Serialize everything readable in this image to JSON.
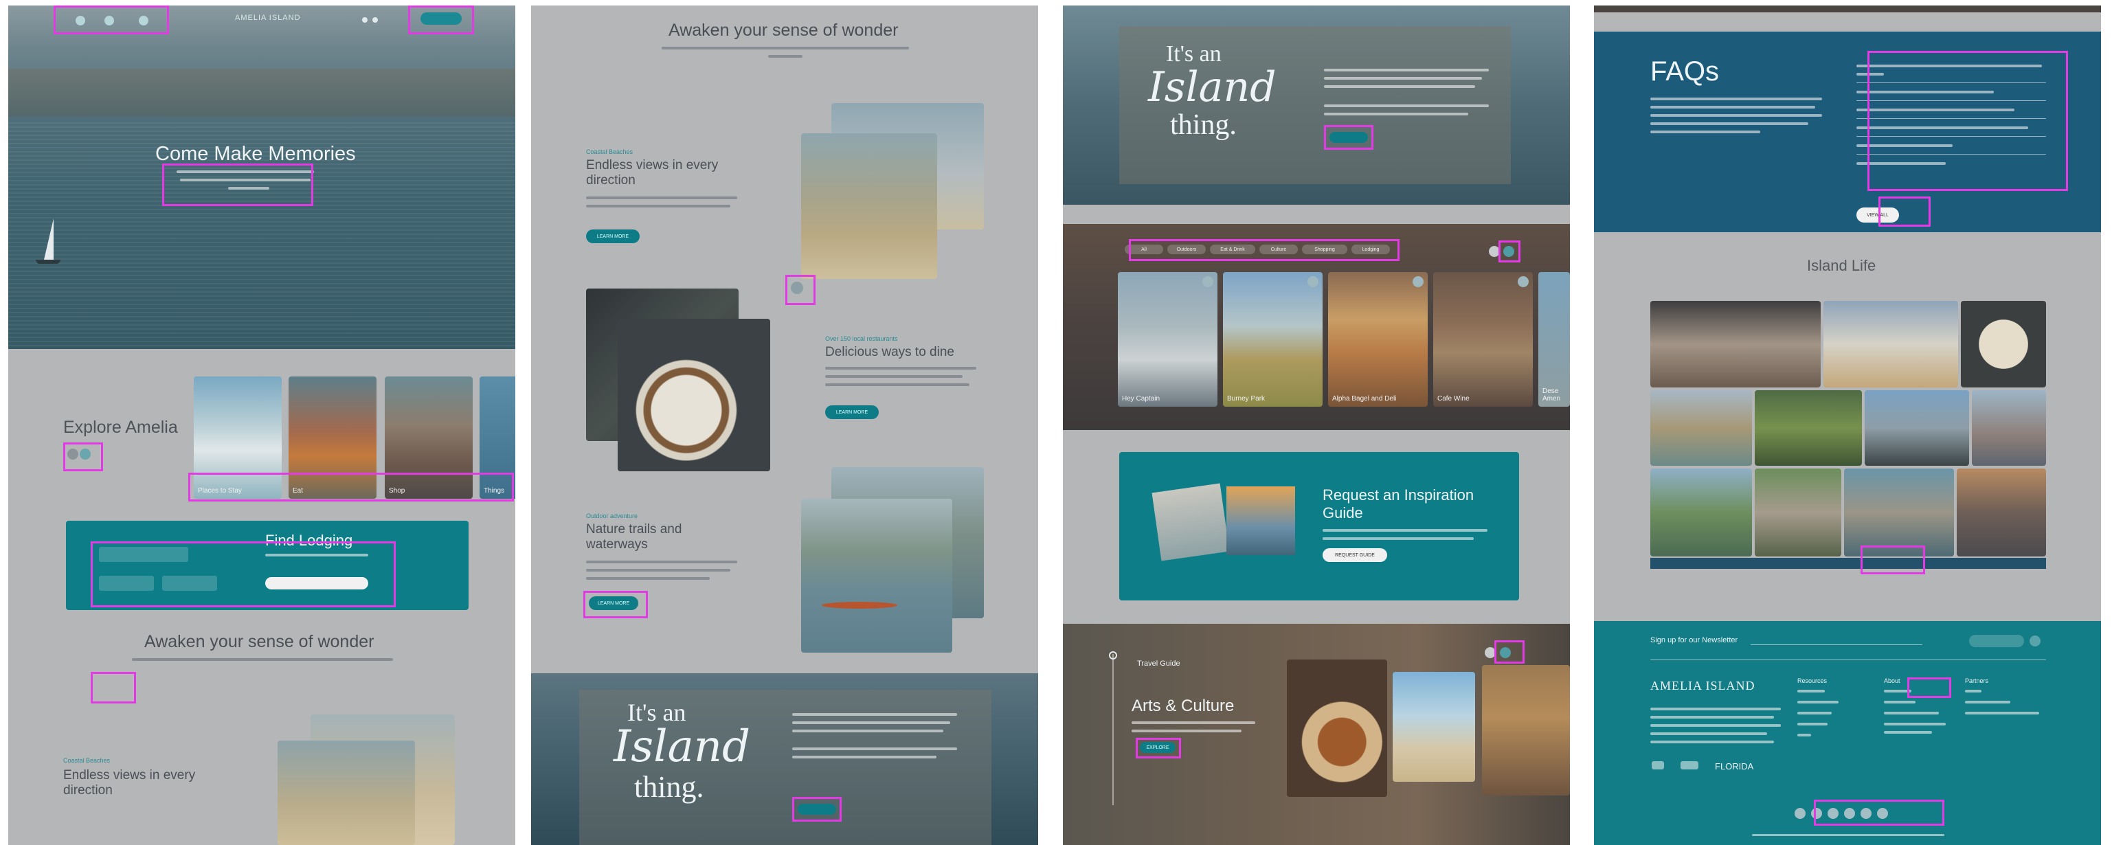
{
  "panel1": {
    "site_logo": "AMELIA ISLAND",
    "hero_title": "Come Make Memories",
    "explore_title": "Explore Amelia",
    "cards": [
      {
        "label": "Places to Stay"
      },
      {
        "label": "Eat"
      },
      {
        "label": "Shop"
      },
      {
        "label": "Things"
      }
    ],
    "find_lodging": "Find Lodging",
    "awaken_title": "Awaken your sense of wonder",
    "views_eyebrow": "Coastal Beaches",
    "views_title": "Endless views in every direction"
  },
  "panel2": {
    "awaken_title": "Awaken your sense of wonder",
    "sections": [
      {
        "eyebrow": "Coastal Beaches",
        "title": "Endless views in every direction",
        "button": "LEARN MORE"
      },
      {
        "eyebrow": "Over 150 local restaurants",
        "title": "Delicious ways to dine",
        "button": "LEARN MORE"
      },
      {
        "eyebrow": "Outdoor adventure",
        "title": "Nature trails and waterways",
        "button": "LEARN MORE"
      }
    ],
    "island_its_an": "It's an",
    "island_island": "Island",
    "island_thing": "thing."
  },
  "panel3": {
    "island_its_an": "It's an",
    "island_island": "Island",
    "island_thing": "thing.",
    "filter_tabs": [
      "All",
      "Outdoors",
      "Eat & Drink",
      "Culture",
      "Shopping",
      "Lodging"
    ],
    "carousel": [
      {
        "label": "Hey Captain"
      },
      {
        "label": "Burney Park"
      },
      {
        "label": "Alpha Bagel and Deli"
      },
      {
        "label": "Cafe Wine"
      },
      {
        "label": "Dese Amen"
      }
    ],
    "guide_title": "Request an Inspiration Guide",
    "guide_button": "REQUEST GUIDE",
    "arts_eyebrow": "Travel Guide",
    "arts_title": "Arts & Culture",
    "arts_button": "EXPLORE"
  },
  "panel4": {
    "faq_title": "FAQs",
    "faq_button": "VIEW ALL",
    "island_life_title": "Island Life",
    "newsletter_label": "Sign up for our Newsletter",
    "footer_logo": "AMELIA ISLAND",
    "footer_col_heads": [
      "Resources",
      "About",
      "Partners"
    ],
    "florida_mark": "FLORIDA"
  },
  "colors": {
    "teal": "#0d7e88",
    "navy": "#0e5a7c",
    "highlight": "#e23be3",
    "overlay": "#b4b6b8"
  }
}
